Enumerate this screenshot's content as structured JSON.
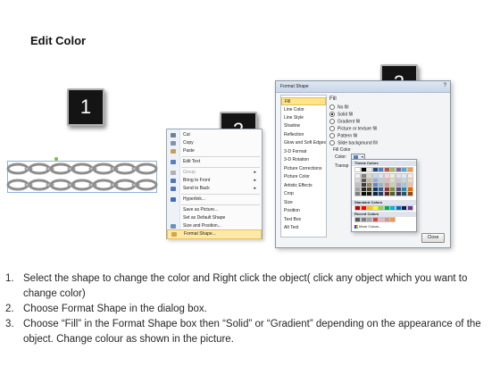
{
  "title": "Edit Color",
  "steps": [
    "1",
    "2",
    "3"
  ],
  "context_menu": {
    "items": [
      {
        "label": "Cut",
        "icon": "scissors-icon",
        "color": "#6f7f99"
      },
      {
        "label": "Copy",
        "icon": "copy-icon",
        "color": "#7f93b3"
      },
      {
        "label": "Paste",
        "icon": "paste-icon",
        "color": "#c4a060"
      },
      {
        "label": "Edit Text",
        "icon": "edit-text-icon",
        "color": "#5b7fb8"
      },
      {
        "label": "Group",
        "icon": "group-icon",
        "color": "#b0b0b0",
        "submenu": true,
        "disabled": true
      },
      {
        "label": "Bring to Front",
        "icon": "bring-front-icon",
        "color": "#4f78b8",
        "submenu": true
      },
      {
        "label": "Send to Back",
        "icon": "send-back-icon",
        "color": "#4f78b8",
        "submenu": true
      },
      {
        "label": "Hyperlink...",
        "icon": "hyperlink-icon",
        "color": "#3e6fb0"
      },
      {
        "label": "Save as Picture...",
        "icon": "",
        "color": ""
      },
      {
        "label": "Set as Default Shape",
        "icon": "",
        "color": ""
      },
      {
        "label": "Size and Position...",
        "icon": "size-position-icon",
        "color": "#6f8fbf"
      },
      {
        "label": "Format Shape...",
        "icon": "format-shape-icon",
        "color": "#d8a44a",
        "highlighted": true
      }
    ]
  },
  "dialog": {
    "title": "Format Shape",
    "close_glyph": "?",
    "categories": [
      "Fill",
      "Line Color",
      "Line Style",
      "Shadow",
      "Reflection",
      "Glow and Soft Edges",
      "3-D Format",
      "3-D Rotation",
      "Picture Corrections",
      "Picture Color",
      "Artistic Effects",
      "Crop",
      "Size",
      "Position",
      "Text Box",
      "Alt Text"
    ],
    "selected_category": "Fill",
    "fill_heading": "Fill",
    "fill_options": [
      {
        "label": "No fill",
        "checked": false
      },
      {
        "label": "Solid fill",
        "checked": true
      },
      {
        "label": "Gradient fill",
        "checked": false
      },
      {
        "label": "Picture or texture fill",
        "checked": false
      },
      {
        "label": "Pattern fill",
        "checked": false
      }
    ],
    "slide_bg_label": "Slide background fill",
    "fill_color_label": "Fill Color",
    "color_label": "Color:",
    "transparency_label": "Transp",
    "close_label": "Close"
  },
  "palette": {
    "theme_label": "Theme Colors",
    "standard_label": "Standard Colors",
    "recent_label": "Recent Colors",
    "more_label": "More Colors...",
    "theme_top": [
      "#ffffff",
      "#000000",
      "#eeece1",
      "#1f497d",
      "#4f81bd",
      "#c0504d",
      "#9bbb59",
      "#8064a2",
      "#4bacc6",
      "#f79646"
    ],
    "theme_shades": [
      [
        "#f2f2f2",
        "#7f7f7f",
        "#ddd9c3",
        "#c6d9f0",
        "#dbe5f1",
        "#f2dcdb",
        "#ebf1dd",
        "#e5e0ec",
        "#dbeef3",
        "#fdeada"
      ],
      [
        "#d8d8d8",
        "#595959",
        "#c4bd97",
        "#8db3e2",
        "#b8cce4",
        "#e5b9b7",
        "#d7e3bc",
        "#ccc1d9",
        "#b7dde8",
        "#fbd5b5"
      ],
      [
        "#bfbfbf",
        "#3f3f3f",
        "#938953",
        "#548dd4",
        "#95b3d7",
        "#d99694",
        "#c3d69b",
        "#b2a2c7",
        "#92cddc",
        "#fac08f"
      ],
      [
        "#a5a5a5",
        "#262626",
        "#494429",
        "#17365d",
        "#366092",
        "#953734",
        "#76923c",
        "#5f497a",
        "#31859b",
        "#e36c09"
      ],
      [
        "#7f7f7f",
        "#0c0c0c",
        "#1d1b10",
        "#0f243e",
        "#244061",
        "#632423",
        "#4f6128",
        "#3f3151",
        "#205867",
        "#974806"
      ]
    ],
    "standard": [
      "#c00000",
      "#ff0000",
      "#ffc000",
      "#ffff00",
      "#92d050",
      "#00b050",
      "#00b0f0",
      "#0070c0",
      "#002060",
      "#7030a0"
    ],
    "recent": [
      "#595959",
      "#7f7f7f",
      "#a5a5a5",
      "#c0504d",
      "#e5b9b7",
      "#d99694",
      "#f79646"
    ]
  },
  "instructions": [
    {
      "num": "1.",
      "text": "Select the shape to change the color and Right click the object( click any object which you want to change color)"
    },
    {
      "num": "2.",
      "text": "Choose Format Shape in the dialog box."
    },
    {
      "num": "3.",
      "text": "Choose “Fill” in the Format Shape box then “Solid” or “Gradient” depending on the appearance of the object. Change colour as shown in the picture."
    }
  ]
}
